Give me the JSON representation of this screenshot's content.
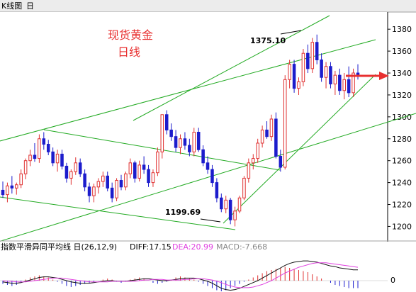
{
  "window": {
    "title": "K线图",
    "title_suffix": "日"
  },
  "annotations": {
    "heading_line1": "现货黄金",
    "heading_line2": "日线",
    "high_label": "1375.10",
    "low_label": "1199.69",
    "heading_color": "#e83030",
    "arrow_color": "#e83030"
  },
  "colors": {
    "up": "#e03030",
    "down": "#1c1ccc",
    "channel": "#22aa22",
    "diff_line": "#111111",
    "dea_line": "#e040e0",
    "macd_pos": "#e03030",
    "macd_neg": "#1c1ccc"
  },
  "macd_header": {
    "name": "指数平滑异同平均线 日(26,12,9)",
    "diff_text": "DIFF:17.15",
    "dea_text": "DEA:20.99",
    "macd_text": "MACD:-7.668",
    "zero_label": "0"
  },
  "chart_data": {
    "type": "candlestick",
    "title": "",
    "ylim": [
      1188,
      1395
    ],
    "y_ticks": [
      1200,
      1220,
      1240,
      1260,
      1280,
      1300,
      1320,
      1340,
      1360,
      1380
    ],
    "grid": false,
    "ohlc": [
      [
        1233,
        1241,
        1226,
        1229
      ],
      [
        1229,
        1240,
        1222,
        1237
      ],
      [
        1237,
        1246,
        1230,
        1235
      ],
      [
        1235,
        1240,
        1229,
        1238
      ],
      [
        1238,
        1252,
        1235,
        1248
      ],
      [
        1248,
        1262,
        1243,
        1260
      ],
      [
        1260,
        1270,
        1255,
        1265
      ],
      [
        1265,
        1276,
        1259,
        1262
      ],
      [
        1262,
        1284,
        1258,
        1280
      ],
      [
        1280,
        1286,
        1270,
        1275
      ],
      [
        1275,
        1279,
        1265,
        1268
      ],
      [
        1268,
        1272,
        1255,
        1258
      ],
      [
        1258,
        1270,
        1250,
        1266
      ],
      [
        1266,
        1270,
        1252,
        1255
      ],
      [
        1255,
        1258,
        1240,
        1244
      ],
      [
        1244,
        1252,
        1238,
        1250
      ],
      [
        1250,
        1263,
        1247,
        1258
      ],
      [
        1258,
        1262,
        1245,
        1248
      ],
      [
        1248,
        1252,
        1232,
        1236
      ],
      [
        1236,
        1240,
        1222,
        1228
      ],
      [
        1228,
        1239,
        1222,
        1236
      ],
      [
        1236,
        1244,
        1230,
        1241
      ],
      [
        1241,
        1250,
        1236,
        1246
      ],
      [
        1246,
        1250,
        1232,
        1235
      ],
      [
        1235,
        1240,
        1222,
        1226
      ],
      [
        1226,
        1244,
        1223,
        1242
      ],
      [
        1242,
        1247,
        1233,
        1236
      ],
      [
        1236,
        1250,
        1233,
        1248
      ],
      [
        1248,
        1262,
        1244,
        1258
      ],
      [
        1258,
        1260,
        1240,
        1244
      ],
      [
        1244,
        1260,
        1241,
        1256
      ],
      [
        1256,
        1264,
        1248,
        1252
      ],
      [
        1252,
        1256,
        1236,
        1240
      ],
      [
        1240,
        1252,
        1236,
        1249
      ],
      [
        1249,
        1272,
        1246,
        1268
      ],
      [
        1268,
        1284,
        1262,
        1302
      ],
      [
        1302,
        1306,
        1284,
        1288
      ],
      [
        1288,
        1294,
        1278,
        1282
      ],
      [
        1282,
        1288,
        1268,
        1272
      ],
      [
        1272,
        1284,
        1266,
        1280
      ],
      [
        1280,
        1286,
        1270,
        1274
      ],
      [
        1274,
        1280,
        1264,
        1268
      ],
      [
        1268,
        1290,
        1264,
        1286
      ],
      [
        1286,
        1290,
        1268,
        1270
      ],
      [
        1270,
        1274,
        1255,
        1258
      ],
      [
        1258,
        1264,
        1248,
        1252
      ],
      [
        1252,
        1256,
        1236,
        1240
      ],
      [
        1240,
        1244,
        1222,
        1226
      ],
      [
        1226,
        1230,
        1213,
        1216
      ],
      [
        1216,
        1228,
        1212,
        1224
      ],
      [
        1224,
        1226,
        1202,
        1206
      ],
      [
        1206,
        1218,
        1200,
        1214
      ],
      [
        1214,
        1228,
        1212,
        1226
      ],
      [
        1226,
        1246,
        1224,
        1244
      ],
      [
        1244,
        1262,
        1240,
        1258
      ],
      [
        1258,
        1266,
        1252,
        1262
      ],
      [
        1262,
        1280,
        1258,
        1276
      ],
      [
        1276,
        1292,
        1272,
        1288
      ],
      [
        1288,
        1296,
        1280,
        1282
      ],
      [
        1282,
        1302,
        1278,
        1298
      ],
      [
        1298,
        1304,
        1262,
        1264
      ],
      [
        1264,
        1270,
        1250,
        1254
      ],
      [
        1254,
        1338,
        1252,
        1334
      ],
      [
        1334,
        1352,
        1326,
        1348
      ],
      [
        1348,
        1352,
        1322,
        1326
      ],
      [
        1326,
        1336,
        1320,
        1332
      ],
      [
        1332,
        1362,
        1328,
        1358
      ],
      [
        1358,
        1366,
        1340,
        1344
      ],
      [
        1344,
        1372,
        1340,
        1368
      ],
      [
        1368,
        1375.1,
        1348,
        1352
      ],
      [
        1352,
        1358,
        1332,
        1336
      ],
      [
        1336,
        1350,
        1326,
        1346
      ],
      [
        1346,
        1350,
        1326,
        1330
      ],
      [
        1330,
        1342,
        1320,
        1338
      ],
      [
        1338,
        1344,
        1320,
        1324
      ],
      [
        1324,
        1340,
        1316,
        1334
      ],
      [
        1334,
        1346,
        1318,
        1322
      ],
      [
        1322,
        1344,
        1318,
        1340
      ],
      [
        1340,
        1348,
        1334,
        1338
      ]
    ],
    "macd_histogram": [
      -3,
      -4,
      -5,
      -4,
      -2,
      1,
      3,
      4,
      5,
      4,
      3,
      1,
      -1,
      -3,
      -5,
      -6,
      -5,
      -4,
      -3,
      -2,
      -1,
      0,
      1,
      2,
      1,
      -1,
      -2,
      -1,
      1,
      2,
      3,
      2,
      0,
      -2,
      -3,
      -2,
      -1,
      1,
      3,
      4,
      3,
      2,
      1,
      -1,
      -3,
      -5,
      -7,
      -9,
      -10,
      -9,
      -7,
      -5,
      -3,
      -1,
      1,
      3,
      5,
      7,
      9,
      10,
      11,
      12,
      13,
      12,
      11,
      10,
      9,
      8,
      6,
      4,
      2,
      0,
      -2,
      -4,
      -5,
      -6,
      -7,
      -7,
      -7
    ],
    "diff": [
      -2,
      -3,
      -4,
      -4,
      -3,
      -1,
      1,
      3,
      5,
      6,
      6,
      5,
      4,
      2,
      0,
      -2,
      -3,
      -4,
      -4,
      -4,
      -3,
      -2,
      -1,
      0,
      0,
      -1,
      -1,
      -1,
      0,
      1,
      2,
      3,
      3,
      2,
      1,
      0,
      0,
      1,
      2,
      3,
      4,
      4,
      4,
      3,
      1,
      -1,
      -4,
      -8,
      -12,
      -14,
      -15,
      -14,
      -12,
      -9,
      -6,
      -3,
      0,
      4,
      8,
      12,
      16,
      20,
      24,
      27,
      29,
      30,
      31,
      31,
      30,
      29,
      27,
      25,
      23,
      22,
      20,
      19,
      18,
      17,
      17
    ],
    "dea": [
      0,
      -1,
      -1,
      -2,
      -2,
      -2,
      -1,
      0,
      1,
      2,
      3,
      4,
      4,
      4,
      3,
      2,
      1,
      0,
      -1,
      -2,
      -2,
      -2,
      -2,
      -2,
      -1,
      -1,
      -1,
      -1,
      -1,
      -1,
      0,
      1,
      1,
      2,
      2,
      2,
      1,
      1,
      1,
      1,
      2,
      2,
      3,
      3,
      3,
      2,
      1,
      -1,
      -3,
      -6,
      -8,
      -10,
      -11,
      -11,
      -11,
      -10,
      -8,
      -6,
      -3,
      0,
      4,
      8,
      12,
      15,
      18,
      21,
      23,
      25,
      27,
      28,
      28,
      28,
      27,
      26,
      25,
      24,
      23,
      22,
      21
    ]
  }
}
